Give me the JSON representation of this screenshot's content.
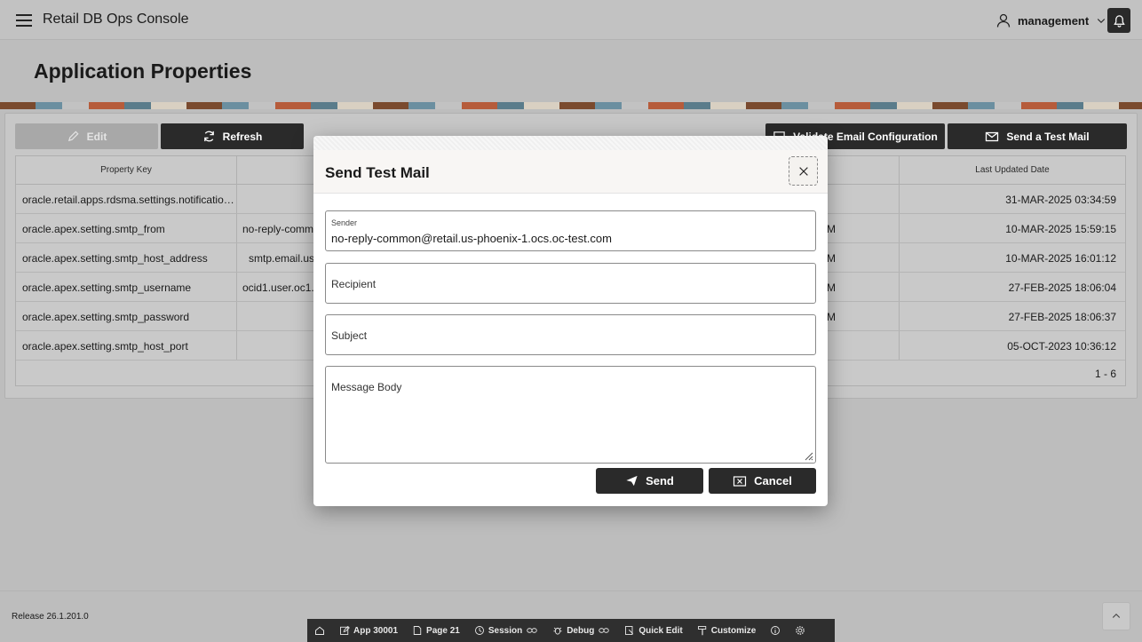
{
  "header": {
    "app_title": "Retail DB Ops Console",
    "user": "management"
  },
  "page": {
    "title": "Application Properties"
  },
  "toolbar": {
    "edit_label": "Edit",
    "refresh_label": "Refresh",
    "validate_label": "Validate Email Configuration",
    "send_test_label": "Send a Test Mail"
  },
  "grid": {
    "columns": [
      "Property Key",
      "Last Updated Date"
    ],
    "rows": [
      {
        "key": "oracle.retail.apps.rdsma.settings.notificatio…",
        "value": "",
        "mid": "",
        "date": "31-MAR-2025 03:34:59"
      },
      {
        "key": "oracle.apex.setting.smtp_from",
        "value": "no-reply-comm",
        "mid": "M",
        "date": "10-MAR-2025 15:59:15"
      },
      {
        "key": "oracle.apex.setting.smtp_host_address",
        "value": "smtp.email.us-",
        "mid": "M",
        "date": "10-MAR-2025 16:01:12"
      },
      {
        "key": "oracle.apex.setting.smtp_username",
        "value": "ocid1.user.oc1..a",
        "mid": "M",
        "date": "27-FEB-2025 18:06:04"
      },
      {
        "key": "oracle.apex.setting.smtp_password",
        "value": "",
        "mid": "M",
        "date": "27-FEB-2025 18:06:37"
      },
      {
        "key": "oracle.apex.setting.smtp_host_port",
        "value": "",
        "mid": "",
        "date": "05-OCT-2023 10:36:12"
      }
    ],
    "pagination": "1 - 6"
  },
  "dialog": {
    "title": "Send Test Mail",
    "sender_label": "Sender",
    "sender_value": "no-reply-common@retail.us-phoenix-1.ocs.oc-test.com",
    "recipient_label": "Recipient",
    "subject_label": "Subject",
    "message_label": "Message Body",
    "send_label": "Send",
    "cancel_label": "Cancel"
  },
  "footer": {
    "release": "Release 26.1.201.0"
  },
  "devbar": {
    "app": "App 30001",
    "page": "Page 21",
    "session": "Session",
    "debug": "Debug",
    "quick_edit": "Quick Edit",
    "customize": "Customize"
  }
}
